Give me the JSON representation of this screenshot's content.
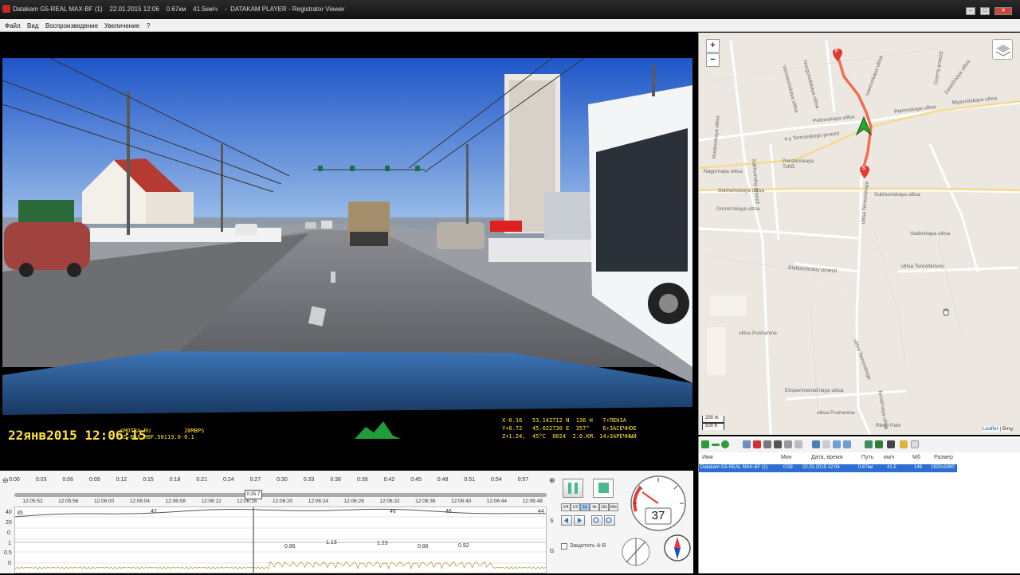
{
  "window": {
    "title": "Datakam G5-REAL MAX-BF (1)    22.01.2015 12:06    0.67км    41.5км/ч    -  DATAKAM PLAYER - Registrator Viewer",
    "btn_min": "–",
    "btn_max": "□",
    "btn_close": "✕"
  },
  "menu": [
    "Файл",
    "Вид",
    "Воспроизведение",
    "Увеличение",
    "?"
  ],
  "osd": {
    "date": "22янв2015 12:06:15",
    "mid": "SMOTRA.RU          20MBPS\nG5-MAX RBF.50119.0-0.1",
    "right": "X-0.16   53.142712 N  136 H   7↑ПЕНЗА\nY+0.72   45.022730 E  357°    6↑ЗАСЕЧНОЕ\nZ+1.24,  45°C  0024  2.0.КМ. 14↗ЗАРЕЧНЫЙ"
  },
  "map": {
    "zoom_in": "+",
    "zoom_out": "−",
    "marker_finish": "F",
    "marker_start": "S",
    "streets": [
      {
        "name": "Petrovskaya ulitsa"
      },
      {
        "name": "Petrovskaya ulitsa"
      },
      {
        "name": "Myasnitskaya ulitsa"
      },
      {
        "name": "4-y Ternovskogo proezd"
      },
      {
        "name": "Nagornaya ulitsa"
      },
      {
        "name": "Sukhumskaya ulitsa"
      },
      {
        "name": "Sukhumskaya ulitsa"
      },
      {
        "name": "Gomel'skaya ulitsa"
      },
      {
        "name": "Vadinskaya ulitsa"
      },
      {
        "name": "ulitsa Tereshkovoy"
      },
      {
        "name": "Elektricheskiy proezd"
      },
      {
        "name": "ulitsa Pushanina"
      },
      {
        "name": "ulitsa Pushanina"
      },
      {
        "name": "Eksperimental'naya ulitsa"
      },
      {
        "name": "Riteyl Park"
      },
      {
        "name": "Penzenskaya TsKB"
      },
      {
        "name": "Sukhumskiy proezd"
      },
      {
        "name": "ulitsa Ternovskogo"
      },
      {
        "name": "ulitsa Ternovskogo"
      },
      {
        "name": "Ternal'naya ulitsa"
      },
      {
        "name": "Ivanovskaya ulitsa"
      },
      {
        "name": "Rostovskaya ulitsa"
      },
      {
        "name": "Voronezhskaya ulitsa"
      },
      {
        "name": "Novgorodskaya ulitsa"
      },
      {
        "name": "Zarechnaya ulitsa"
      },
      {
        "name": "Ozerny proezd"
      }
    ],
    "scale_m": "200 m",
    "scale_ft": "500 ft",
    "attribution_link": "Leaflet",
    "attribution_rest": " | Bing"
  },
  "files": {
    "columns": [
      "Имя",
      "Мин",
      "Дата, время",
      "Путь",
      "км/ч",
      "Мб",
      "Размер"
    ],
    "rows": [
      {
        "name": "Datakam G5-REAL MAX-BF (1)",
        "min": "0:59",
        "datetime": "22.01.2015 12:06",
        "path": "0.67км",
        "speed": "41.5",
        "mb": "146",
        "size": "1920x1080"
      }
    ]
  },
  "timeline": {
    "ticks": [
      "0:00",
      "0:03",
      "0:06",
      "0:09",
      "0:12",
      "0:15",
      "0:18",
      "0:21",
      "0:24",
      "0:27",
      "0:30",
      "0:33",
      "0:36",
      "0:39",
      "0:42",
      "0:45",
      "0:48",
      "0:51",
      "0:54",
      "0:57"
    ],
    "cursor": "0:25.7",
    "clock_ticks": [
      "12:05:52",
      "12:05:56",
      "12:06:00",
      "12:06:04",
      "12:06:08",
      "12:06:12",
      "12:06:16",
      "12:06:20",
      "12:06:24",
      "12:06:28",
      "12:06:32",
      "12:06:36",
      "12:06:40",
      "12:06:44",
      "12:06:48"
    ],
    "zoom_out": "⊖",
    "zoom_in": "⊕"
  },
  "chart_data": {
    "type": "line",
    "speed": {
      "axis_label": "S",
      "yticks": [
        "40",
        "20",
        "0"
      ],
      "ylim": [
        0,
        45
      ],
      "start_label": "35",
      "peak_labels": [
        "42",
        "46",
        "46",
        "44"
      ]
    },
    "gforce": {
      "axis_label": "G",
      "yticks": [
        "1",
        "0.5",
        "0"
      ],
      "ylim": [
        0,
        1.3
      ],
      "peak_labels": [
        "0.86",
        "1.13",
        "1.23",
        "0.86",
        "0.92"
      ]
    }
  },
  "controls": {
    "rates": [
      "1/4",
      "1/2",
      "1x",
      "4x",
      "16x",
      "64x"
    ],
    "protect_label": "Защитить A-B",
    "speed_value": "37"
  }
}
